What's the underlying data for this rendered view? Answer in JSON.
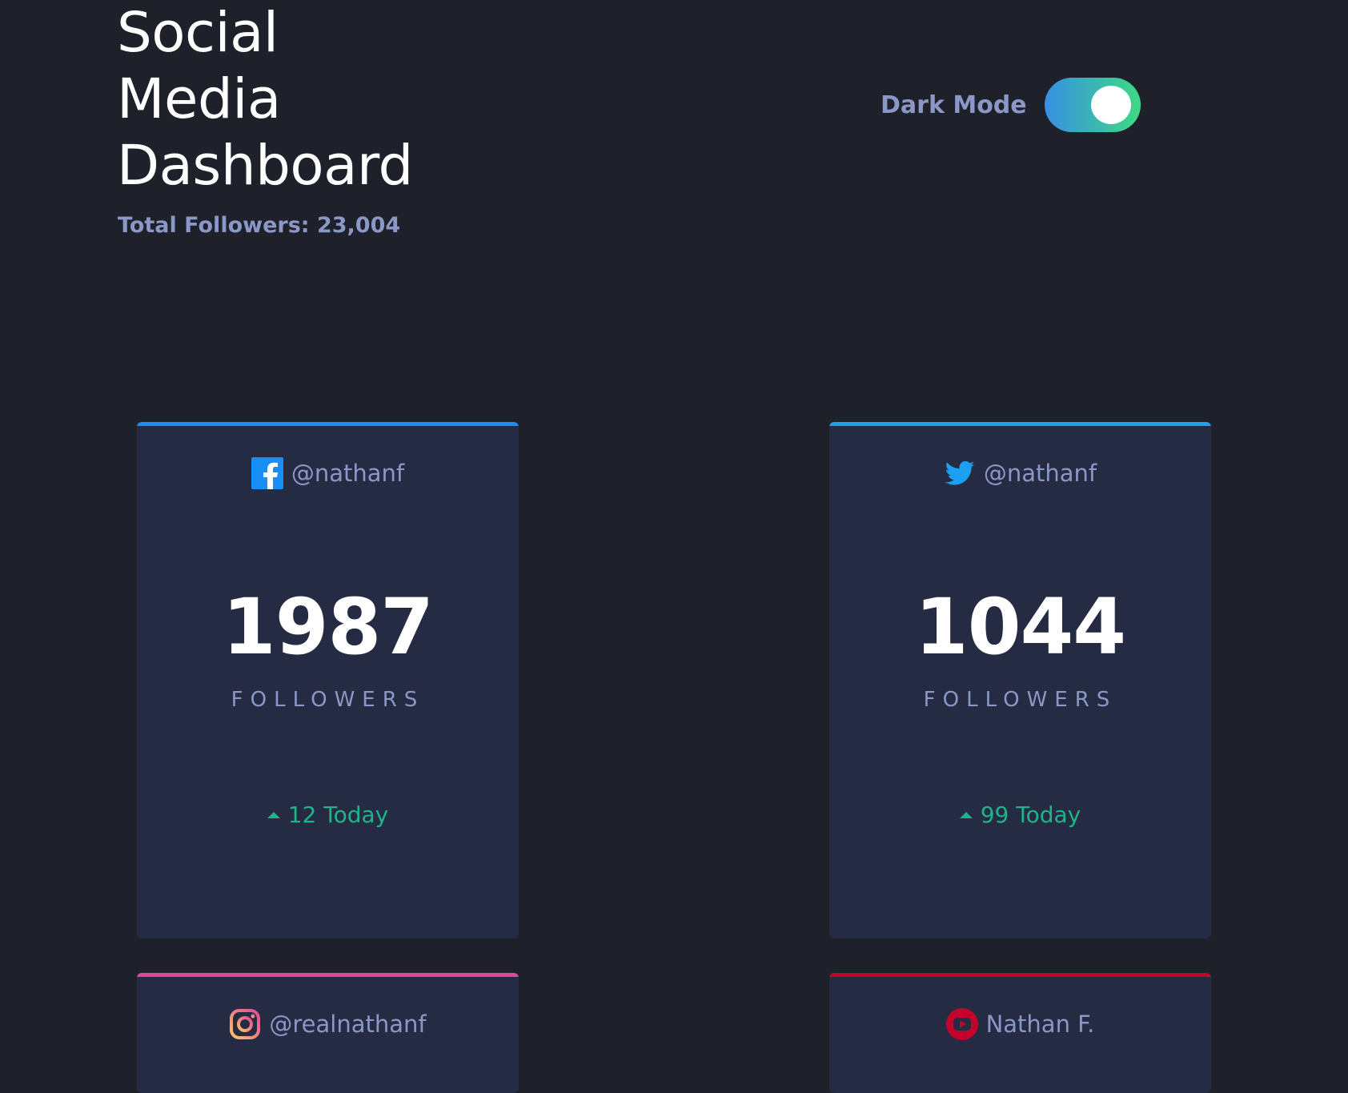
{
  "header": {
    "title_lines": [
      "Social",
      "Media",
      "Dashboard"
    ],
    "total_followers": "Total Followers: 23,004"
  },
  "mode": {
    "label": "Dark Mode",
    "enabled": true
  },
  "cards": [
    {
      "platform": "facebook",
      "icon": "facebook-icon",
      "accent": "#198ef5",
      "handle": "@nathanf",
      "count": "1987",
      "label": "FOLLOWERS",
      "today": "12 Today"
    },
    {
      "platform": "twitter",
      "icon": "twitter-icon",
      "accent": "#1ca0f2",
      "handle": "@nathanf",
      "count": "1044",
      "label": "FOLLOWERS",
      "today": "99 Today"
    },
    {
      "platform": "instagram",
      "icon": "instagram-icon",
      "accent": "#df4996",
      "handle": "@realnathanf"
    },
    {
      "platform": "youtube",
      "icon": "youtube-icon",
      "accent": "#c4032b",
      "handle": "Nathan F."
    }
  ],
  "colors": {
    "background": "#1e202a",
    "card": "#252b43",
    "muted_text": "#8b97c6",
    "positive": "#1db489"
  }
}
